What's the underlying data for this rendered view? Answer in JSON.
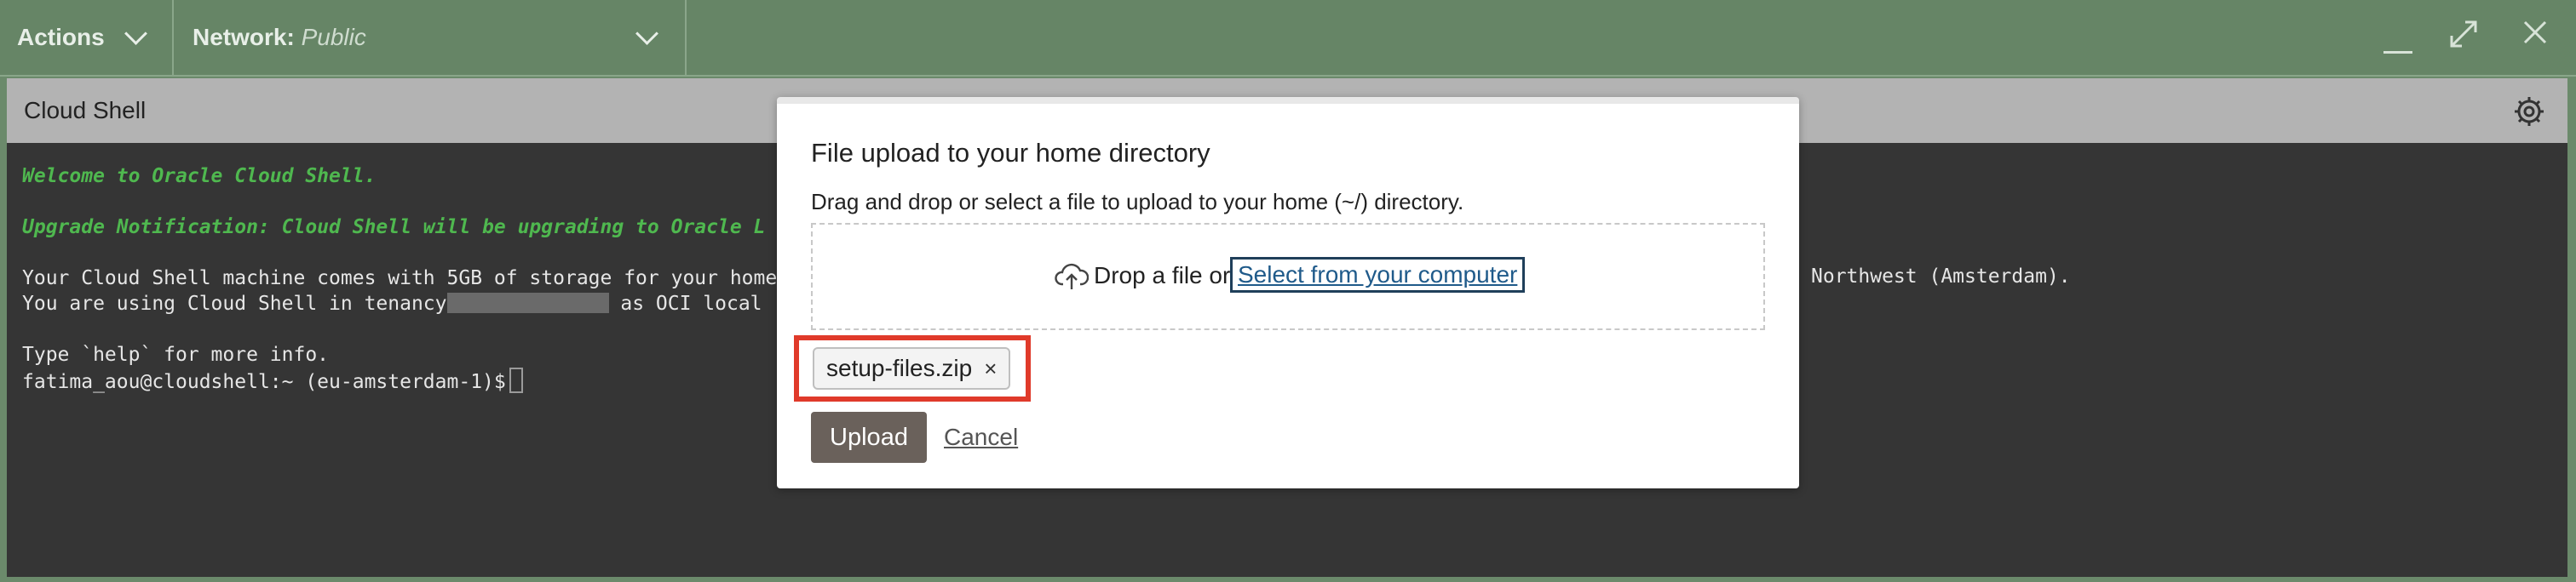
{
  "topbar": {
    "actions_label": "Actions",
    "network_label": "Network:",
    "network_value": "Public"
  },
  "shell": {
    "title": "Cloud Shell",
    "terminal": {
      "line1": "Welcome to Oracle Cloud Shell.",
      "line2": "Upgrade Notification: Cloud Shell will be upgrading to Oracle L",
      "line3": "Your Cloud Shell machine comes with 5GB of storage for your home",
      "line4_prefix": "You are using Cloud Shell in tenancy",
      "line4_suffix": " as OCI local",
      "line5": "Type `help` for more info.",
      "prompt": "fatima_aou@cloudshell:~ (eu-amsterdam-1)$",
      "right_text": "Northwest (Amsterdam)."
    }
  },
  "dialog": {
    "title": "File upload to your home directory",
    "description": "Drag and drop or select a file to upload to your home (~/) directory.",
    "drop_text": "Drop a file or",
    "select_link": "Select from your computer",
    "file_chip": "setup-files.zip",
    "chip_remove": "×",
    "upload_label": "Upload",
    "cancel_label": "Cancel"
  },
  "colors": {
    "topbar": "#668566",
    "terminal_bg": "#353535",
    "green_text": "#4fb84f",
    "highlight": "#e03a2a",
    "upload_button": "#6a615b"
  }
}
